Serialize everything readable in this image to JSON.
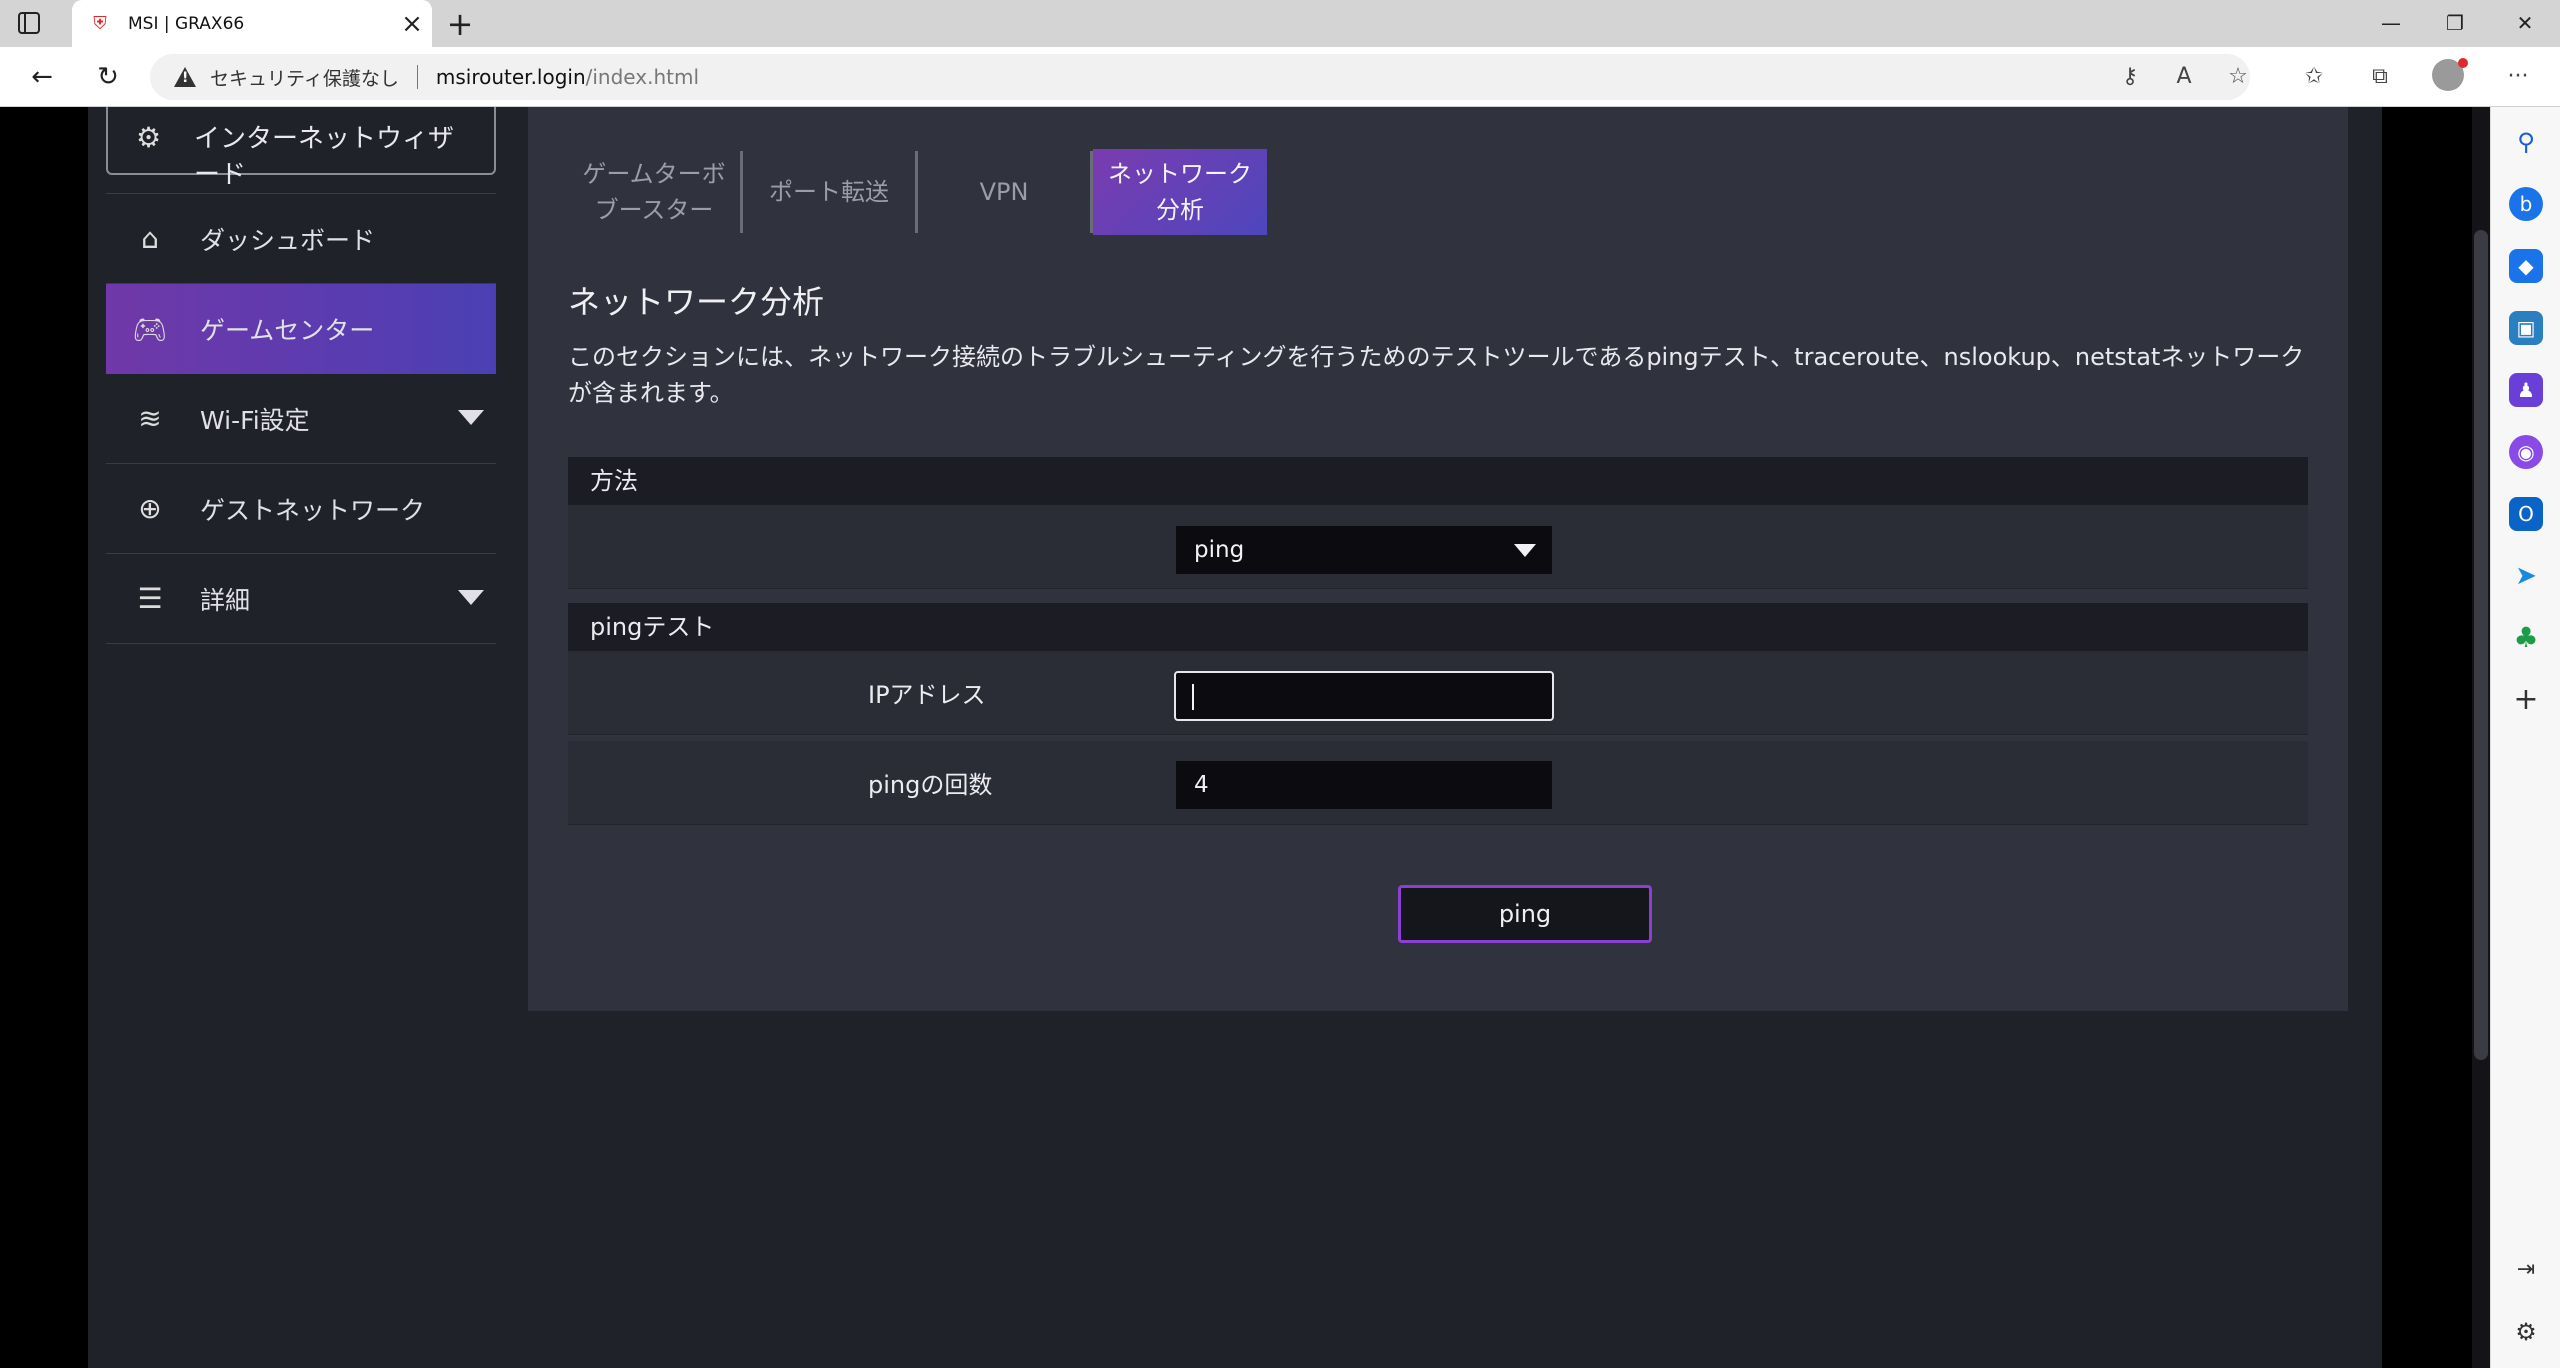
{
  "browser": {
    "tab_title": "MSI | GRAX66",
    "security_text": "セキュリティ保護なし",
    "url_host": "msirouter.login",
    "url_path": "/index.html"
  },
  "sidebar": {
    "wizard_label": "インターネットウィザード",
    "items": [
      {
        "label": "ダッシュボード",
        "icon": "home-icon"
      },
      {
        "label": "ゲームセンター",
        "icon": "gamepad-icon",
        "active": true
      },
      {
        "label": "Wi-Fi設定",
        "icon": "wifi-icon",
        "expandable": true
      },
      {
        "label": "ゲストネットワーク",
        "icon": "globe-icon"
      },
      {
        "label": "詳細",
        "icon": "sliders-icon",
        "expandable": true
      }
    ]
  },
  "tabs": {
    "game_turbo": "ゲームターボブースター",
    "port_forward": "ポート転送",
    "vpn": "VPN",
    "net_analysis": "ネットワーク分析"
  },
  "section": {
    "title": "ネットワーク分析",
    "description": "このセクションには、ネットワーク接続のトラブルシューティングを行うためのテストツールであるpingテスト、traceroute、nslookup、netstatネットワークが含まれます。"
  },
  "method": {
    "header": "方法",
    "selected": "ping"
  },
  "ping_test": {
    "header": "pingテスト",
    "ip_label": "IPアドレス",
    "ip_value": "",
    "count_label": "pingの回数",
    "count_value": "4",
    "button_label": "ping"
  },
  "colors": {
    "accent_start": "#7038a8",
    "accent_end": "#4a40b4",
    "panel_bg": "#30323d",
    "app_bg": "#202229"
  }
}
